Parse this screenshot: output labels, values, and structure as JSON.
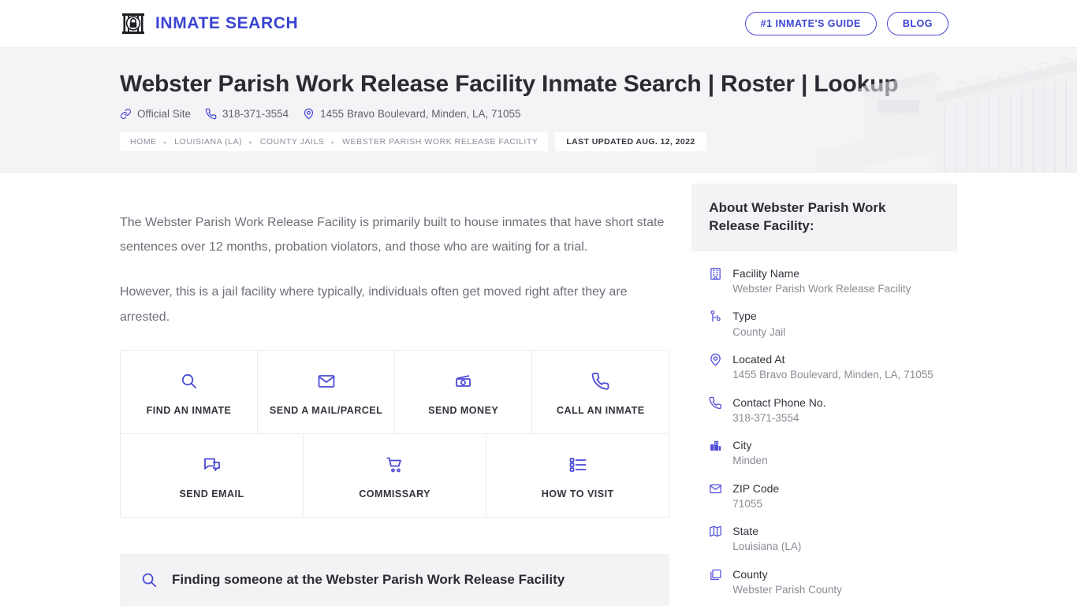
{
  "header": {
    "brand_name": "INMATE SEARCH",
    "brand_icon": "jail-lock-icon",
    "buttons": [
      {
        "label": "#1 INMATE'S GUIDE",
        "name": "inmates-guide-button"
      },
      {
        "label": "BLOG",
        "name": "blog-button"
      }
    ],
    "brand_color": "#3b44d4"
  },
  "hero": {
    "title": "Webster Parish Work Release Facility Inmate Search | Roster | Lookup",
    "meta": [
      {
        "icon": "link-icon",
        "text": "Official Site"
      },
      {
        "icon": "phone-icon",
        "text": "318-371-3554"
      },
      {
        "icon": "map-pin-icon",
        "text": "1455 Bravo Boulevard, Minden, LA, 71055"
      }
    ],
    "breadcrumbs": [
      "HOME",
      "LOUISIANA (LA)",
      "COUNTY JAILS",
      "WEBSTER PARISH WORK RELEASE FACILITY"
    ],
    "last_updated": "LAST UPDATED AUG. 12, 2022",
    "watermark": "prison-guard-tower-fence-image"
  },
  "main": {
    "paragraphs": [
      "The Webster Parish Work Release Facility is primarily built to house inmates that have short state sentences over 12 months, probation violators, and those who are waiting for a trial.",
      "However, this is a jail facility where typically, individuals often get moved right after they are arrested."
    ],
    "tiles_row1": [
      {
        "label": "FIND AN INMATE",
        "icon": "search-icon",
        "name": "tile-find-an-inmate"
      },
      {
        "label": "SEND A MAIL/PARCEL",
        "icon": "envelope-icon",
        "name": "tile-send-a-mail-parcel"
      },
      {
        "label": "SEND MONEY",
        "icon": "banknote-icon",
        "name": "tile-send-money"
      },
      {
        "label": "CALL AN INMATE",
        "icon": "phone-icon",
        "name": "tile-call-an-inmate"
      }
    ],
    "tiles_row2": [
      {
        "label": "SEND EMAIL",
        "icon": "chat-bubbles-icon",
        "name": "tile-send-email"
      },
      {
        "label": "COMMISSARY",
        "icon": "shopping-cart-icon",
        "name": "tile-commissary"
      },
      {
        "label": "HOW TO VISIT",
        "icon": "list-icon",
        "name": "tile-how-to-visit"
      }
    ],
    "section_heading": "Finding someone at the Webster Parish Work Release Facility",
    "section_heading_icon": "search-icon"
  },
  "sidebar": {
    "about_title": "About Webster Parish Work Release Facility:",
    "info": [
      {
        "icon": "building-icon",
        "label": "Facility Name",
        "value": "Webster Parish Work Release Facility"
      },
      {
        "icon": "node-branch-icon",
        "label": "Type",
        "value": "County Jail"
      },
      {
        "icon": "map-pin-icon",
        "label": "Located At",
        "value": "1455 Bravo Boulevard, Minden, LA, 71055"
      },
      {
        "icon": "phone-icon",
        "label": "Contact Phone No.",
        "value": "318-371-3554"
      },
      {
        "icon": "city-icon",
        "label": "City",
        "value": "Minden"
      },
      {
        "icon": "envelope-icon",
        "label": "ZIP Code",
        "value": "71055"
      },
      {
        "icon": "map-icon",
        "label": "State",
        "value": "Louisiana (LA)"
      },
      {
        "icon": "layers-icon",
        "label": "County",
        "value": "Webster Parish County"
      }
    ]
  },
  "colors": {
    "accent": "#3b44d4",
    "icon": "#4b4ad6",
    "text": "#33343d",
    "muted": "#8a8c95",
    "panel": "#f3f3f5"
  }
}
